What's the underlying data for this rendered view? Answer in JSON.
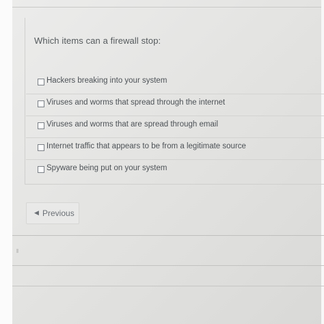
{
  "question": {
    "text": "Which items can a firewall stop:"
  },
  "answers": [
    {
      "label": "Hackers breaking into your system",
      "checked": false
    },
    {
      "label": "Viruses and worms that spread through the internet",
      "checked": false
    },
    {
      "label": "Viruses and worms that are spread through email",
      "checked": false
    },
    {
      "label": "Internet traffic that appears to be from a legitimate source",
      "checked": false
    },
    {
      "label": "Spyware being put on your system",
      "checked": false
    }
  ],
  "navigation": {
    "previous_label": "Previous",
    "previous_icon": "triangle-left-icon"
  }
}
